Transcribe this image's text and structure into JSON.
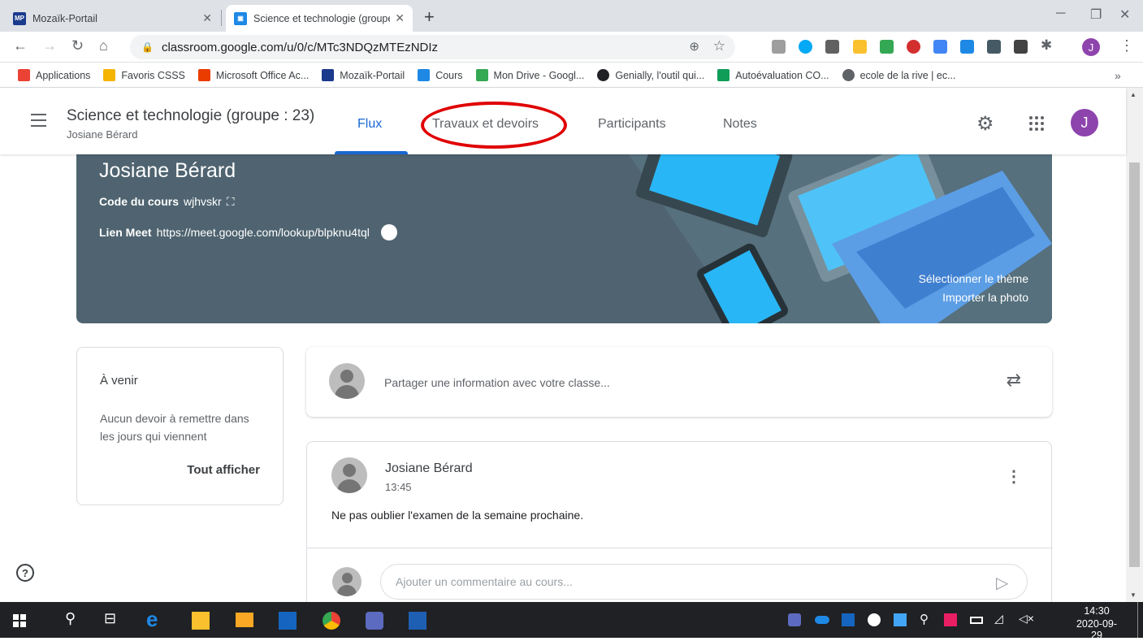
{
  "browser": {
    "tabs": [
      {
        "title": "Mozaïk-Portail",
        "favicon": "MP"
      },
      {
        "title": "Science et technologie (groupe : 23)",
        "favicon": "classroom-icon"
      }
    ],
    "new_tab": "+",
    "address": "classroom.google.com/u/0/c/MTc3NDQzMTEzNDIz",
    "profile_initial": "J",
    "bookmarks_more": "»",
    "bookmarks": [
      {
        "label": "Applications",
        "icon": "apps-icon",
        "color": "#ea4335"
      },
      {
        "label": "Favoris CSSS",
        "icon": "folder-icon",
        "color": "#f4b400"
      },
      {
        "label": "Microsoft Office Ac...",
        "icon": "office-icon",
        "color": "#eb3c00"
      },
      {
        "label": "Mozaïk-Portail",
        "icon": "MP",
        "color": "#1a3a8c"
      },
      {
        "label": "Cours",
        "icon": "classroom-icon",
        "color": "#1e88e5"
      },
      {
        "label": "Mon Drive - Googl...",
        "icon": "drive-icon",
        "color": "#34a853"
      },
      {
        "label": "Genially, l'outil qui...",
        "icon": "genially-icon",
        "color": "#202124"
      },
      {
        "label": "Autoévaluation CO...",
        "icon": "forms-icon",
        "color": "#0f9d58"
      },
      {
        "label": "ecole de la rive | ec...",
        "icon": "globe-icon",
        "color": "#5f6368"
      }
    ]
  },
  "classroom": {
    "title": "Science et technologie (groupe : 23)",
    "teacher": "Josiane Bérard",
    "tabs": [
      "Flux",
      "Travaux et devoirs",
      "Participants",
      "Notes"
    ],
    "active_tab": "Flux",
    "user_initial": "J",
    "banner": {
      "name": "Josiane Bérard",
      "code_label": "Code du cours",
      "code": "wjhvskr",
      "meet_label": "Lien Meet",
      "meet_url": "https://meet.google.com/lookup/blpknu4tql",
      "select_theme": "Sélectionner le thème",
      "import_photo": "Importer la photo",
      "color": "#4f6470"
    },
    "upcoming": {
      "title": "À venir",
      "text": "Aucun devoir à remettre dans les jours qui viennent",
      "view_all": "Tout afficher"
    },
    "share_placeholder": "Partager une information avec votre classe...",
    "post": {
      "author": "Josiane Bérard",
      "time": "13:45",
      "body": "Ne pas oublier l'examen de la semaine prochaine.",
      "comment_placeholder": "Ajouter un commentaire au cours..."
    }
  },
  "taskbar": {
    "time": "14:30",
    "date": "2020-09-29"
  },
  "colors": {
    "accent": "#1967d2",
    "annotation_circle": "#e00000",
    "avatar_purple": "#8e44ad"
  }
}
